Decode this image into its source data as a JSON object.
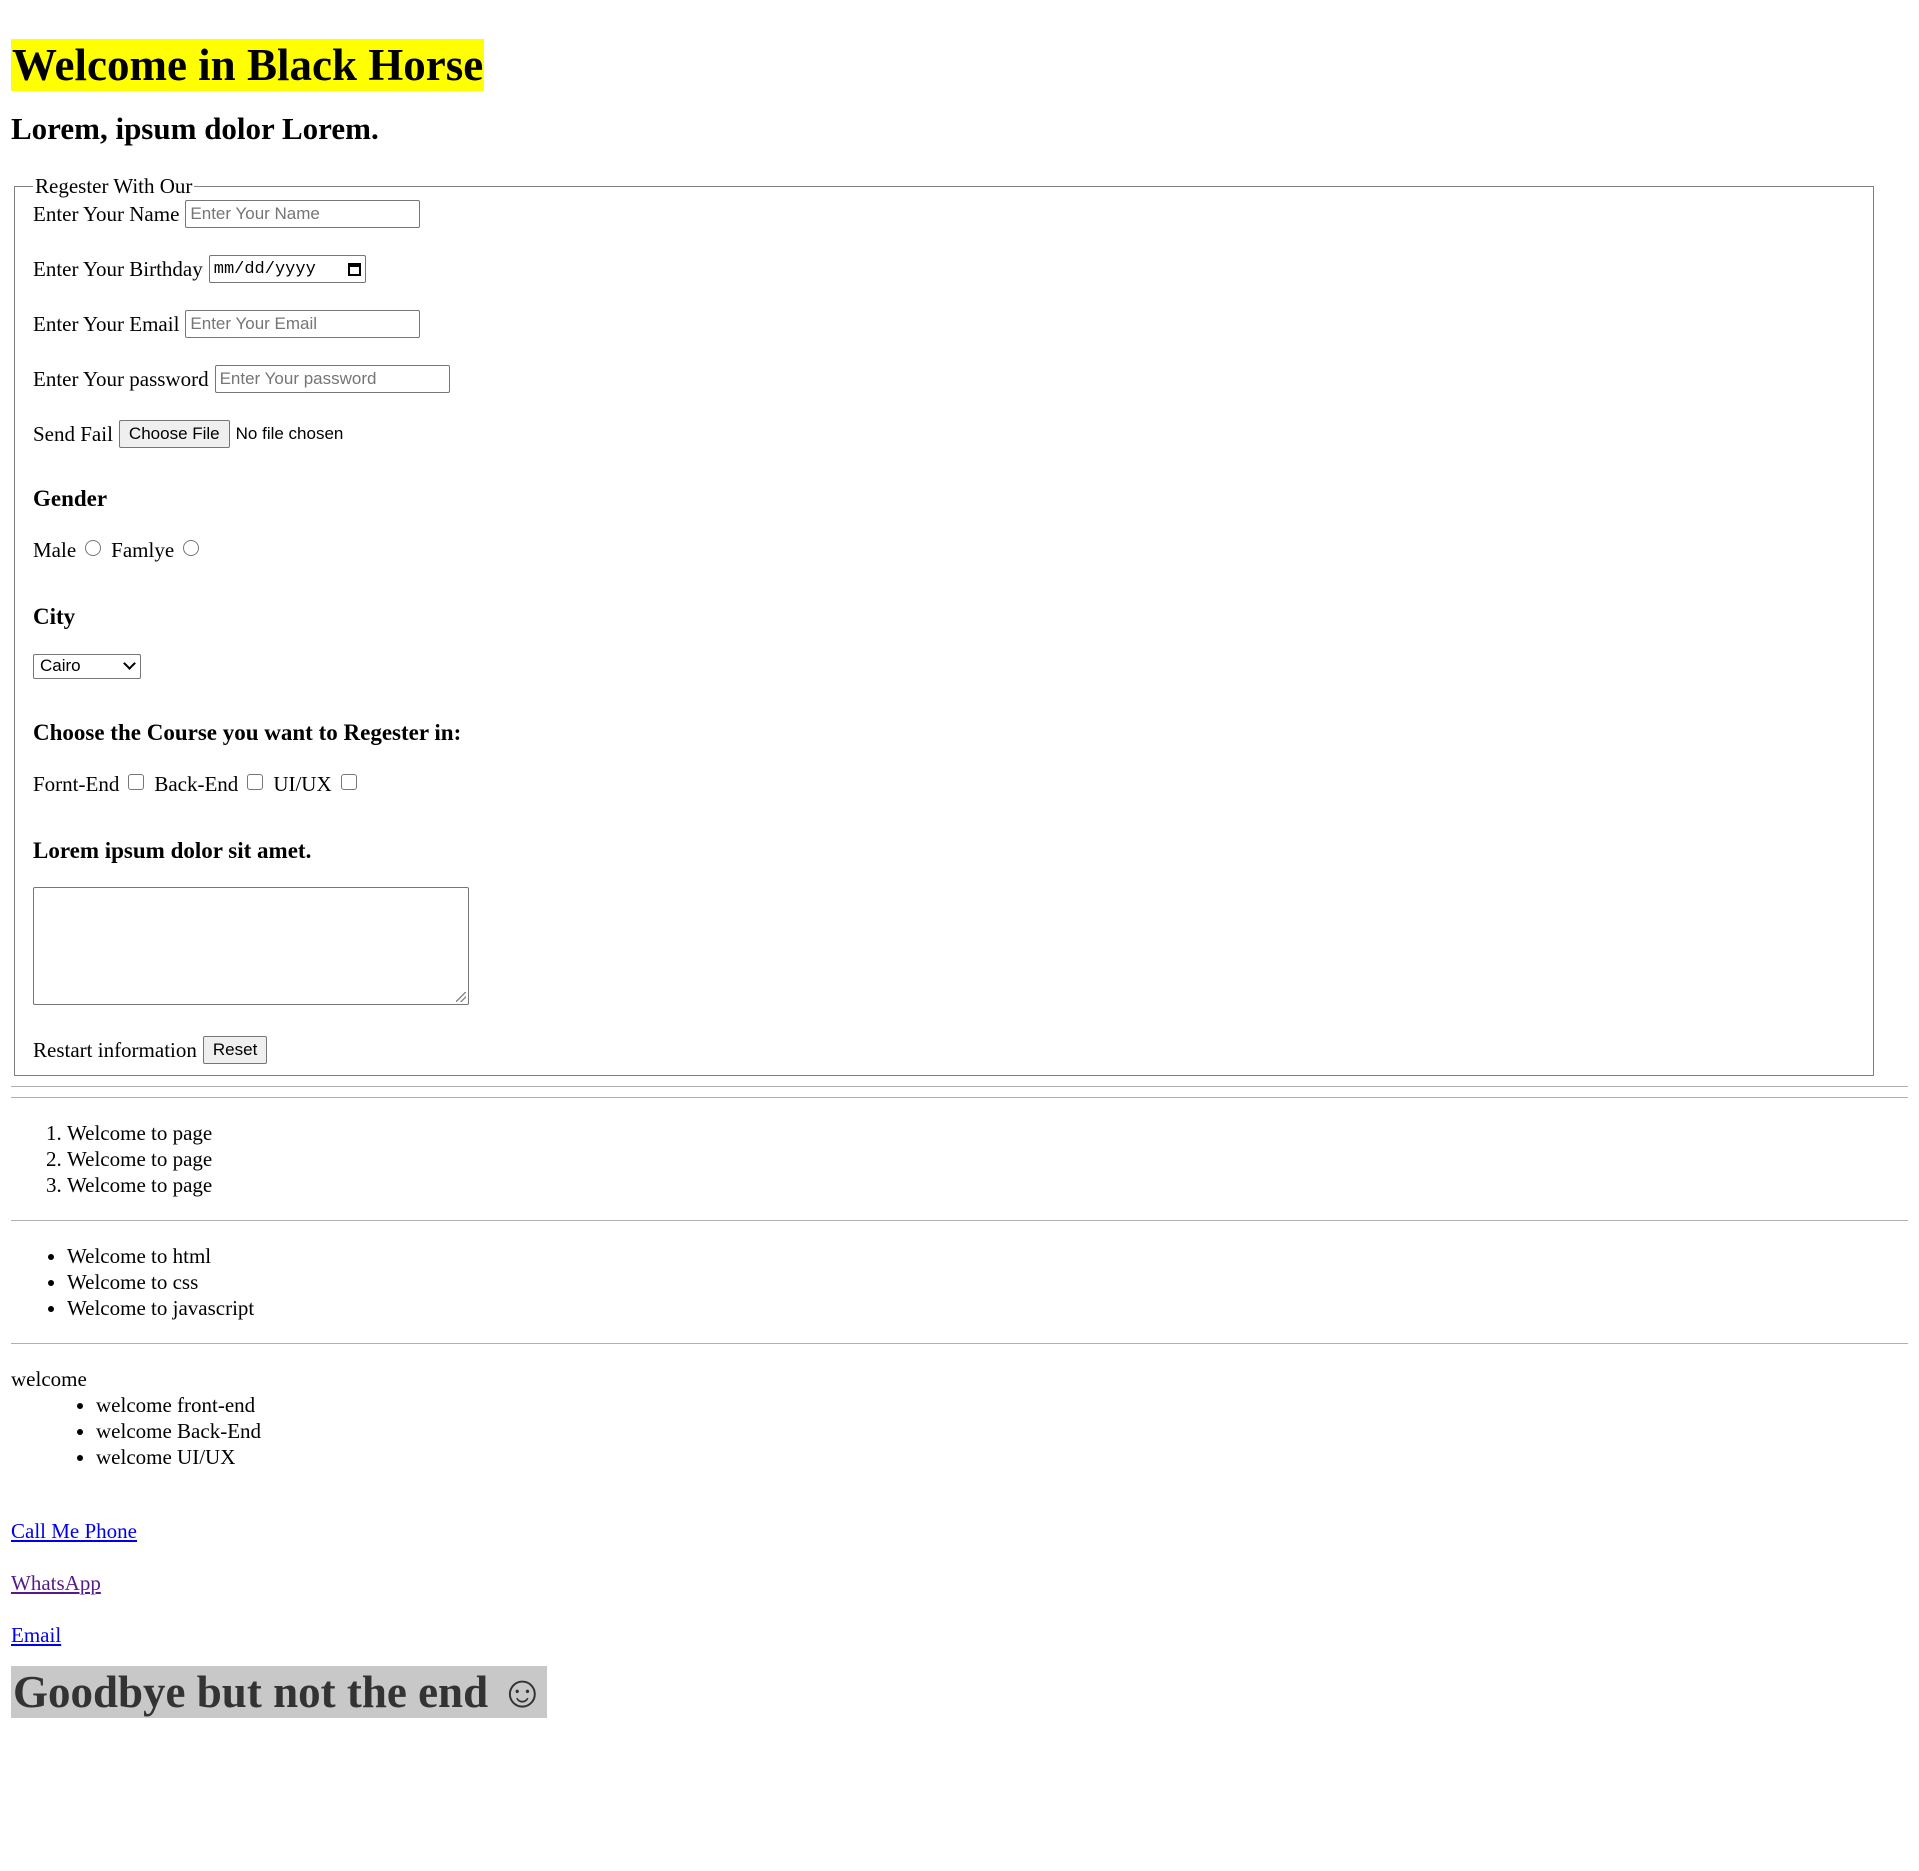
{
  "header": {
    "title": "Welcome in Black Horse",
    "subtitle": "Lorem, ipsum dolor Lorem."
  },
  "form": {
    "legend": "Regester With Our",
    "name": {
      "label": "Enter Your Name",
      "placeholder": "Enter Your Name"
    },
    "birthday": {
      "label": "Enter Your Birthday",
      "placeholder": "mm/dd/yyyy",
      "icon": "calendar-icon"
    },
    "email": {
      "label": "Enter Your Email",
      "placeholder": "Enter Your Email"
    },
    "password": {
      "label": "Enter Your password",
      "placeholder": "Enter Your password"
    },
    "file": {
      "label": "Send Fail",
      "button": "Choose File",
      "status": "No file chosen"
    },
    "gender": {
      "heading": "Gender",
      "options": [
        "Male",
        "Famlye"
      ]
    },
    "city": {
      "heading": "City",
      "selected": "Cairo"
    },
    "course": {
      "heading": "Choose the Course you want to Regester in:",
      "options": [
        "Fornt-End",
        "Back-End",
        "UI/UX"
      ]
    },
    "message": {
      "heading": "Lorem ipsum dolor sit amet."
    },
    "reset": {
      "label": "Restart information",
      "button": "Reset"
    }
  },
  "ordered_list": [
    "Welcome to page",
    "Welcome to page",
    "Welcome to page"
  ],
  "unordered_list": [
    "Welcome to html",
    "Welcome to css",
    "Welcome to javascript"
  ],
  "description": {
    "term": "welcome",
    "items": [
      "welcome front-end",
      "welcome Back-End",
      "welcome UI/UX"
    ]
  },
  "links": {
    "phone": "Call Me Phone",
    "whatsapp": "WhatsApp",
    "email": "Email"
  },
  "footer": {
    "text": "Goodbye but not the end ☺"
  },
  "colors": {
    "title_highlight": "#ffff00",
    "footer_highlight": "#c8c8c8",
    "link": "#0000ee",
    "visited_link": "#551a8b"
  }
}
